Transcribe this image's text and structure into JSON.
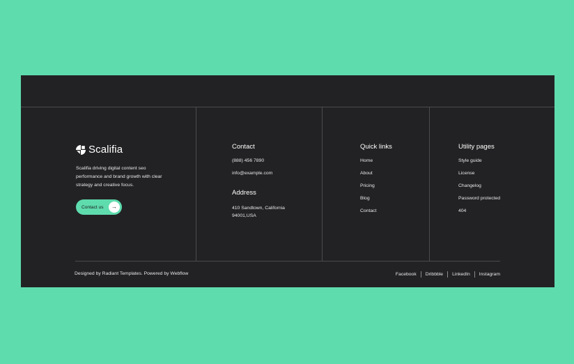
{
  "brand": {
    "name": "Scalifia",
    "description": "Scalifia driving digital content seo performance and brand growth with clear strategy and creative focus.",
    "cta_label": "Contact us",
    "cta_icon": "arrow-right-icon"
  },
  "contact": {
    "title": "Contact",
    "phone": "(888) 456 7890",
    "email": "info@example.com",
    "address_title": "Address",
    "address_line1": "410 Sandtown, California",
    "address_line2": "94001,USA"
  },
  "quick_links": {
    "title": "Quick links",
    "items": [
      "Home",
      "About",
      "Pricing",
      "Blog",
      "Contact"
    ]
  },
  "utility_pages": {
    "title": "Utility pages",
    "items": [
      "Style guide",
      "License",
      "Changelog",
      "Password protected",
      "404"
    ]
  },
  "bottom": {
    "credits": "Designed by Radiant Templates. Powered by Webflow",
    "social": [
      "Facebook",
      "Dribbble",
      "LinkedIn",
      "Instagram"
    ]
  },
  "colors": {
    "page_background": "#5fdcae",
    "footer_background": "#222224",
    "accent": "#5fdcae"
  }
}
